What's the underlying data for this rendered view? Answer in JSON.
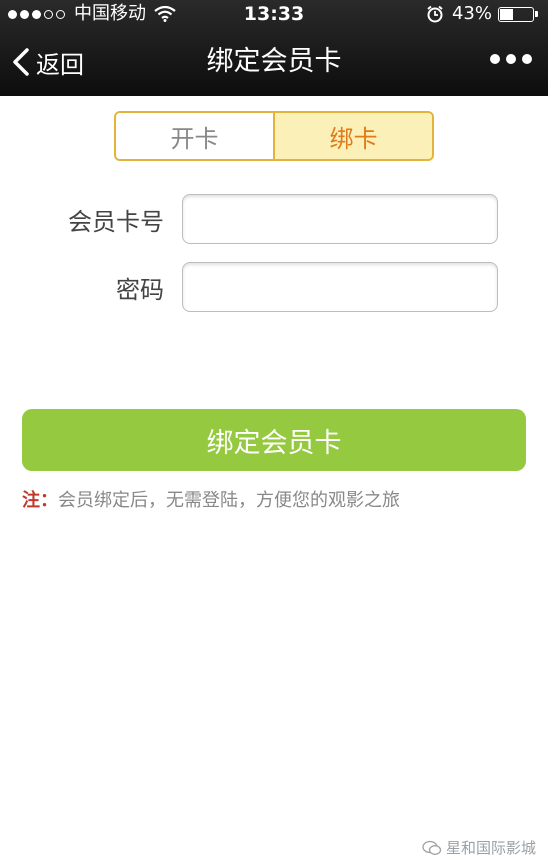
{
  "status_bar": {
    "carrier": "中国移动",
    "time": "13:33",
    "battery_percent": "43%",
    "battery_level": 0.43,
    "signal_bars_filled": 3,
    "signal_bars_total": 5
  },
  "nav": {
    "back_label": "返回",
    "title": "绑定会员卡"
  },
  "tabs": [
    {
      "label": "开卡",
      "active": false
    },
    {
      "label": "绑卡",
      "active": true
    }
  ],
  "form": {
    "card_number_label": "会员卡号",
    "card_number_value": "",
    "password_label": "密码",
    "password_value": ""
  },
  "bind_button_label": "绑定会员卡",
  "note": {
    "prefix": "注：",
    "text": "会员绑定后，无需登陆，方便您的观影之旅"
  },
  "watermark": {
    "text": "星和国际影城"
  },
  "colors": {
    "accent_green": "#95c93f",
    "tab_border": "#e3b33b",
    "tab_active_bg": "#fbf0b8",
    "tab_active_text": "#e07b1a",
    "note_prefix": "#c0392b"
  }
}
